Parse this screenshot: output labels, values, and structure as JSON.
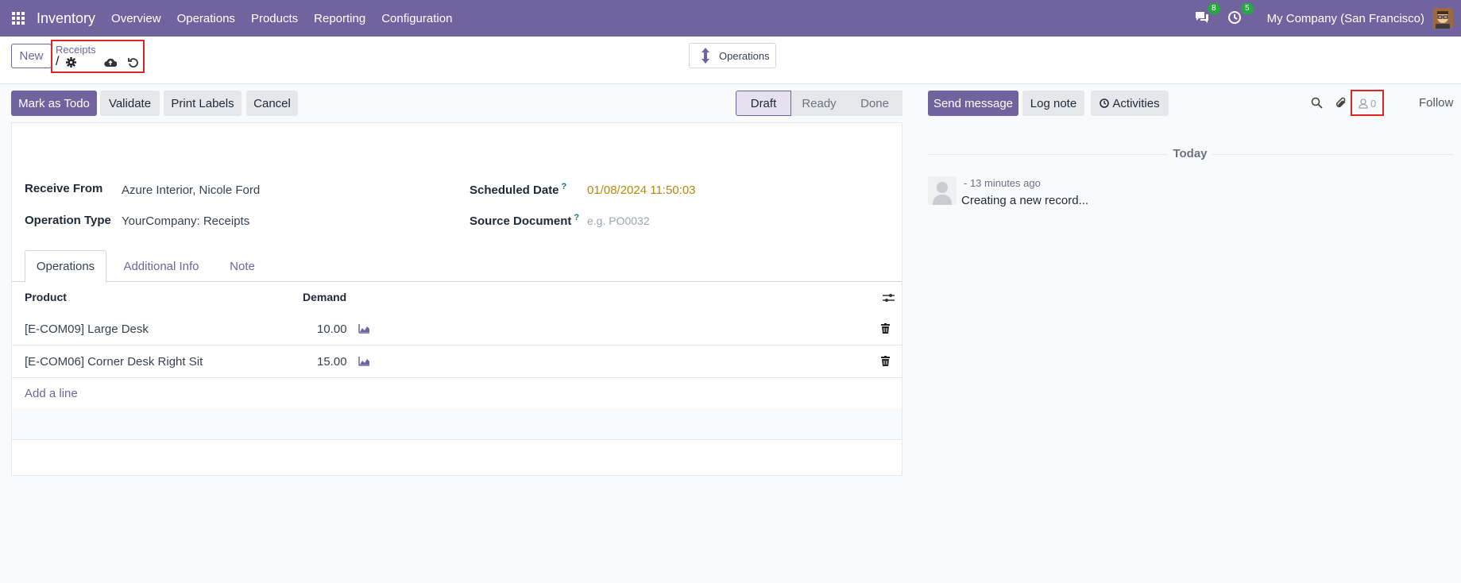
{
  "topnav": {
    "app_name": "Inventory",
    "menu": [
      "Overview",
      "Operations",
      "Products",
      "Reporting",
      "Configuration"
    ],
    "messages_badge": "8",
    "activities_badge": "5",
    "company": "My Company (San Francisco)"
  },
  "control": {
    "new_label": "New",
    "breadcrumb_parent": "Receipts",
    "breadcrumb_current": "/",
    "ops_button": "Operations"
  },
  "actions": {
    "mark_todo": "Mark as Todo",
    "validate": "Validate",
    "print_labels": "Print Labels",
    "cancel": "Cancel"
  },
  "statusbar": [
    "Draft",
    "Ready",
    "Done"
  ],
  "form": {
    "receive_from_label": "Receive From",
    "receive_from_value": "Azure Interior, Nicole Ford",
    "operation_type_label": "Operation Type",
    "operation_type_value": "YourCompany: Receipts",
    "scheduled_date_label": "Scheduled Date",
    "scheduled_date_value": "01/08/2024 11:50:03",
    "source_document_label": "Source Document",
    "source_document_placeholder": "e.g. PO0032",
    "qmark": "?"
  },
  "tabs": [
    "Operations",
    "Additional Info",
    "Note"
  ],
  "table": {
    "headers": {
      "product": "Product",
      "demand": "Demand"
    },
    "rows": [
      {
        "product": "[E-COM09] Large Desk",
        "demand": "10.00"
      },
      {
        "product": "[E-COM06] Corner Desk Right Sit",
        "demand": "15.00"
      }
    ],
    "add_line": "Add a line"
  },
  "chatter": {
    "send_message": "Send message",
    "log_note": "Log note",
    "activities": "Activities",
    "followers_count": "0",
    "follow": "Follow",
    "today": "Today",
    "message_time": "- 13 minutes ago",
    "message_body": "Creating a new record..."
  },
  "colors": {
    "brand": "#71639e",
    "highlight": "#dc2626",
    "date": "#b8860b"
  }
}
